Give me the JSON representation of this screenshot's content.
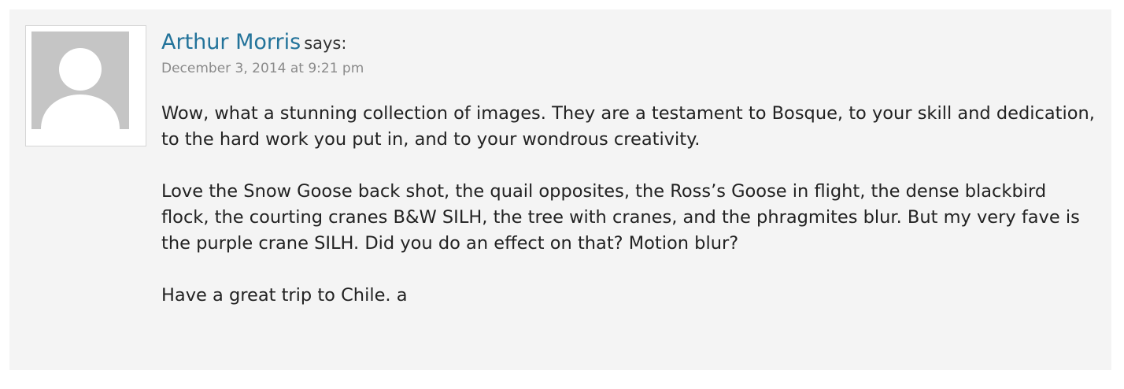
{
  "comment": {
    "author": "Arthur Morris",
    "says": "says:",
    "date": "December 3, 2014 at 9:21 pm",
    "paragraphs": [
      "Wow, what a stunning collection of images. They are a testament to Bosque, to your skill and dedication, to the hard work you put in, and to your wondrous creativity.",
      "Love the Snow Goose back shot, the quail opposites, the Ross’s Goose in flight, the dense blackbird flock, the courting cranes B&W SILH, the tree with cranes, and the phragmites blur. But my very fave is the purple crane SILH. Did you do an effect on that? Motion blur?",
      "Have a great trip to Chile. a"
    ],
    "avatar_icon": "default-avatar-icon"
  },
  "colors": {
    "author_link": "#23739a",
    "date": "#8a8a8a",
    "background": "#f4f4f4",
    "avatar_bg": "#c5c5c5"
  }
}
